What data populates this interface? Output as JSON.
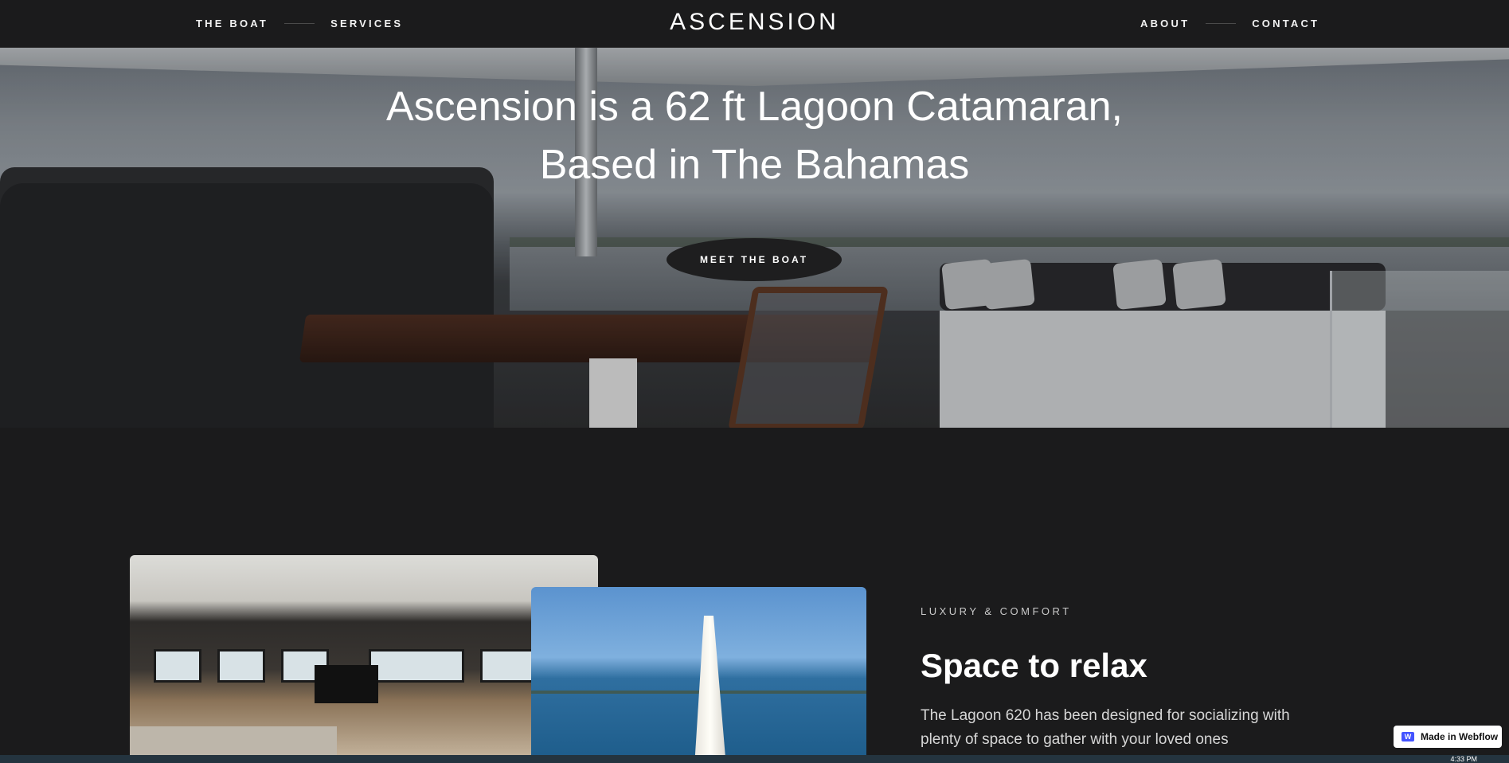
{
  "nav": {
    "left_links": [
      "THE BOAT",
      "SERVICES"
    ],
    "logo": "ASCENSION",
    "right_links": [
      "ABOUT",
      "CONTACT"
    ]
  },
  "hero": {
    "title_line1": "Ascension is a 62 ft Lagoon Catamaran,",
    "title_line2": "Based in The Bahamas",
    "cta_label": "MEET THE BOAT"
  },
  "section": {
    "eyebrow": "LUXURY & COMFORT",
    "title": "Space to relax",
    "body": "The Lagoon 620 has been designed for socializing with plenty of space to gather with your loved ones"
  },
  "badge": {
    "label": "Made in Webflow",
    "icon": "webflow-icon"
  },
  "taskbar": {
    "time": "4:33 PM"
  },
  "colors": {
    "background": "#1b1b1c",
    "text": "#ffffff",
    "button": "#1e1e1f"
  }
}
